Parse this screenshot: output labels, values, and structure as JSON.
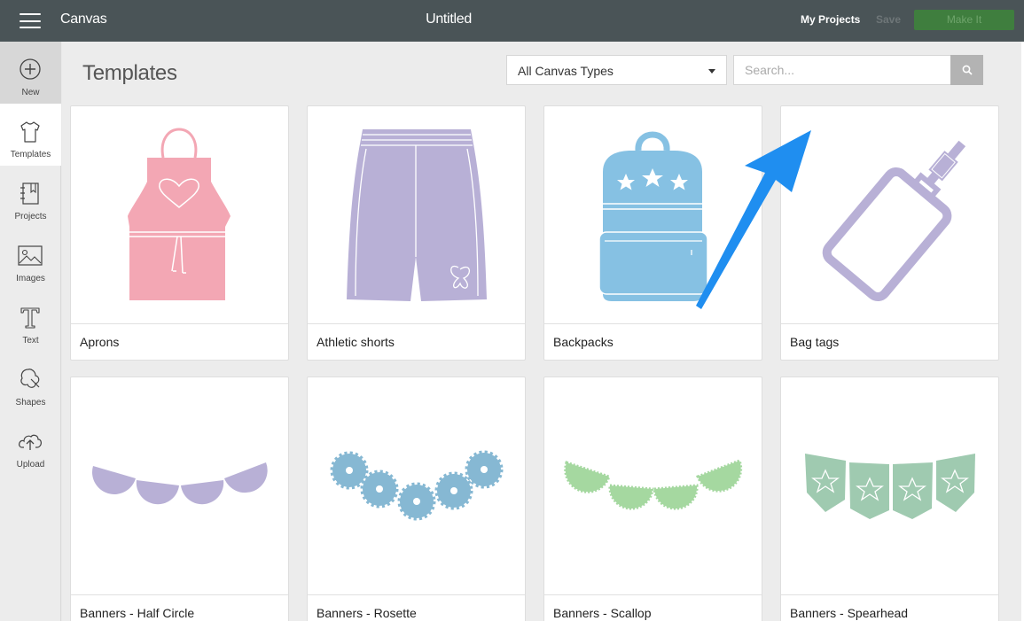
{
  "app": {
    "title": "Canvas",
    "document_title": "Untitled"
  },
  "header": {
    "my_projects": "My Projects",
    "save": "Save",
    "make_it": "Make It"
  },
  "sidebar": {
    "items": [
      {
        "label": "New",
        "icon": "plus-circle-icon"
      },
      {
        "label": "Templates",
        "icon": "tshirt-icon"
      },
      {
        "label": "Projects",
        "icon": "notebook-icon"
      },
      {
        "label": "Images",
        "icon": "image-icon"
      },
      {
        "label": "Text",
        "icon": "text-icon"
      },
      {
        "label": "Shapes",
        "icon": "shapes-icon"
      },
      {
        "label": "Upload",
        "icon": "upload-cloud-icon"
      }
    ]
  },
  "main": {
    "title": "Templates",
    "filter": {
      "selected": "All Canvas Types"
    },
    "search": {
      "placeholder": "Search...",
      "value": ""
    },
    "templates": [
      {
        "label": "Aprons",
        "icon": "apron-icon",
        "color": "#f3a7b4"
      },
      {
        "label": "Athletic shorts",
        "icon": "shorts-icon",
        "color": "#b8b0d6"
      },
      {
        "label": "Backpacks",
        "icon": "backpack-icon",
        "color": "#86c1e3"
      },
      {
        "label": "Bag tags",
        "icon": "bag-tag-icon",
        "color": "#b8b0d6"
      },
      {
        "label": "Banners - Half Circle",
        "icon": "half-circle-banner-icon",
        "color": "#b8b0d6"
      },
      {
        "label": "Banners - Rosette",
        "icon": "rosette-banner-icon",
        "color": "#86b8d3"
      },
      {
        "label": "Banners - Scallop",
        "icon": "scallop-banner-icon",
        "color": "#a5d8a0"
      },
      {
        "label": "Banners - Spearhead",
        "icon": "spearhead-banner-icon",
        "color": "#9fcab0"
      }
    ]
  },
  "colors": {
    "topbar": "#4a5457",
    "make_it": "#3f7e3e",
    "annotation_arrow": "#1f8ef0"
  }
}
